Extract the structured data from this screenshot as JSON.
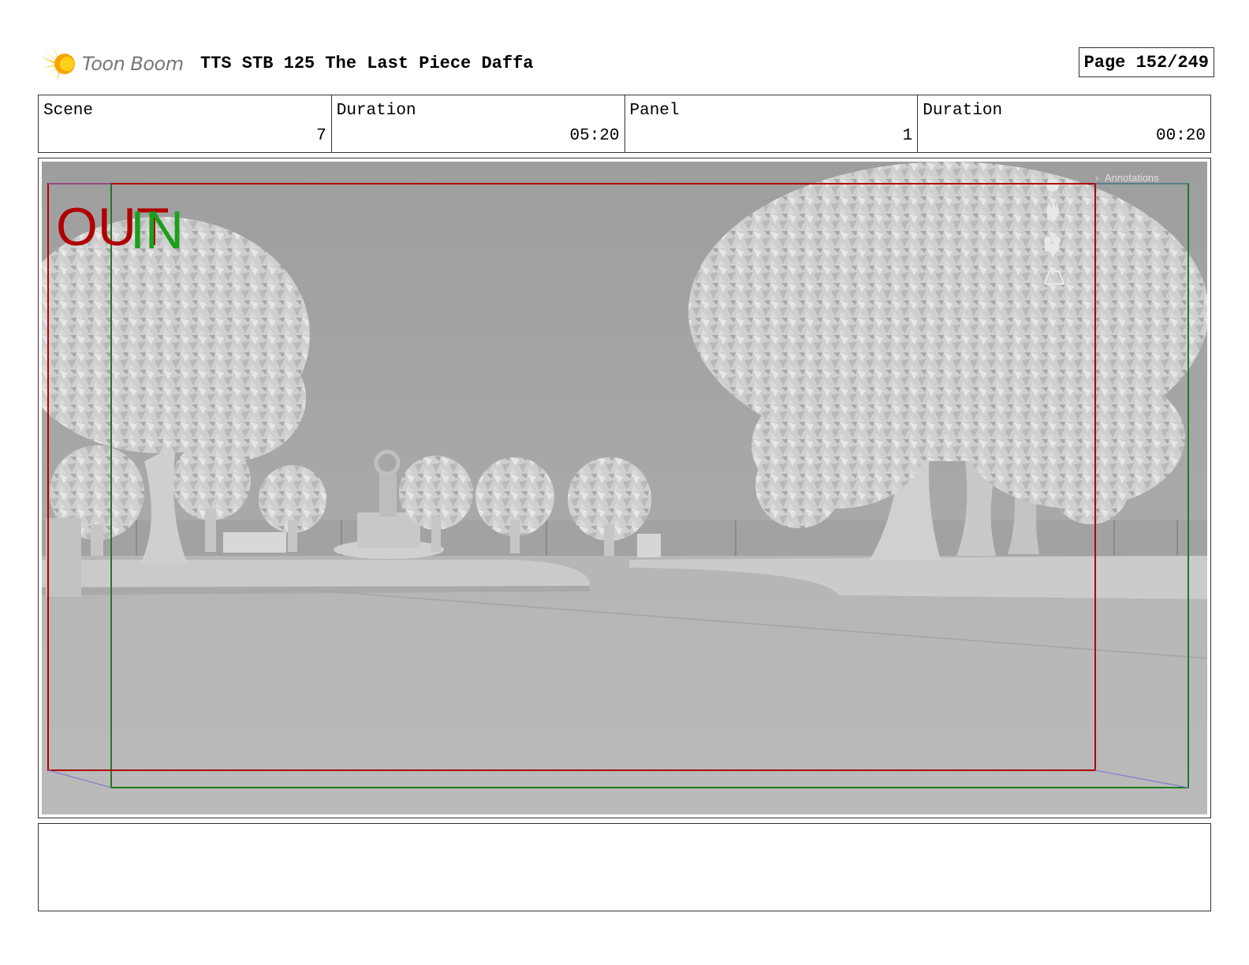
{
  "header": {
    "logo_text": "Toon Boom",
    "title": "TTS STB 125 The Last Piece Daffa",
    "page": "Page 152/249"
  },
  "info": [
    {
      "label": "Scene",
      "value": "7"
    },
    {
      "label": "Duration",
      "value": "05:20"
    },
    {
      "label": "Panel",
      "value": "1"
    },
    {
      "label": "Duration",
      "value": "00:20"
    }
  ],
  "panel": {
    "out_label": "OUT",
    "in_label": "IN",
    "annotations_label": "Annotations",
    "out_color": "#b00000",
    "in_color": "#1aa01a",
    "icons": [
      "zoom-icon",
      "hand-icon",
      "camera-icon",
      "grid-icon"
    ]
  },
  "notes": {
    "text": ""
  }
}
